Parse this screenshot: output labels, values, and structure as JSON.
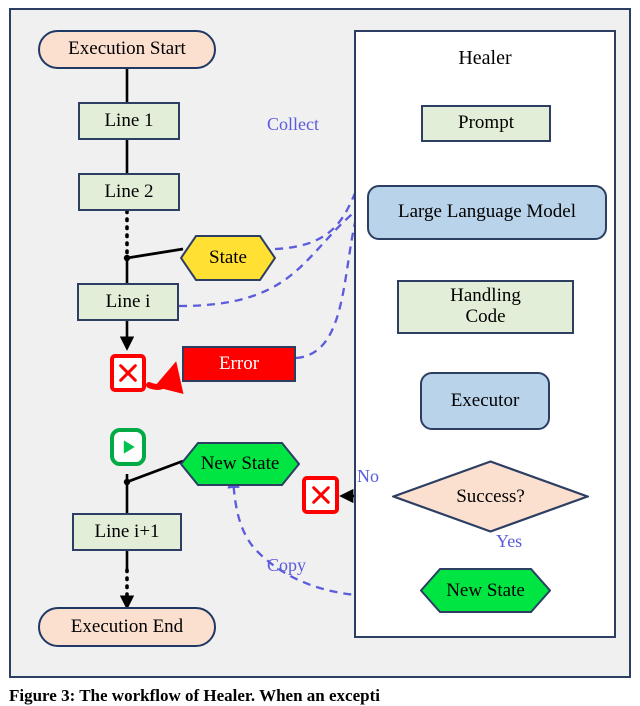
{
  "figure": {
    "caption": "Figure 3: The workflow of Healer. When an excepti",
    "background_color": "#f0f0f0",
    "border_color": "#2c3e62"
  },
  "colors": {
    "terminal_fill": "#fbe0d0",
    "process_fill": "#e2eed7",
    "llm_fill": "#b9d3ea",
    "state_fill": "#ffe033",
    "new_state_fill": "#00e542",
    "error_fill": "#ff0000",
    "outline": "#2c3e62",
    "dashed_edge": "#5b5bdd",
    "error_icon": "#ff0000",
    "play_icon": "#00aa44"
  },
  "left_flow": {
    "nodes": [
      {
        "id": "execution-start",
        "label": "Execution Start",
        "shape": "terminal"
      },
      {
        "id": "line-1",
        "label": "Line 1",
        "shape": "process"
      },
      {
        "id": "line-2",
        "label": "Line 2",
        "shape": "process"
      },
      {
        "id": "state",
        "label": "State",
        "shape": "hexagon"
      },
      {
        "id": "line-i",
        "label": "Line i",
        "shape": "process"
      },
      {
        "id": "error",
        "label": "Error",
        "shape": "error"
      },
      {
        "id": "new-state-left",
        "label": "New State",
        "shape": "hexagon"
      },
      {
        "id": "line-i-plus-1",
        "label": "Line i+1",
        "shape": "process"
      },
      {
        "id": "execution-end",
        "label": "Execution End",
        "shape": "terminal"
      }
    ],
    "icons": [
      {
        "id": "failure-icon",
        "name": "x-mark-icon"
      },
      {
        "id": "resume-icon",
        "name": "play-icon"
      }
    ]
  },
  "healer": {
    "title": "Healer",
    "nodes": [
      {
        "id": "prompt",
        "label": "Prompt",
        "shape": "process"
      },
      {
        "id": "large-language-model",
        "label": "Large Language Model",
        "shape": "rounded"
      },
      {
        "id": "handling-code",
        "label": "Handling",
        "label2": "Code",
        "shape": "process"
      },
      {
        "id": "executor",
        "label": "Executor",
        "shape": "rounded"
      },
      {
        "id": "success",
        "label": "Success?",
        "shape": "diamond"
      },
      {
        "id": "new-state-healer",
        "label": "New State",
        "shape": "hexagon"
      }
    ],
    "icons": [
      {
        "id": "retry-failure-icon",
        "name": "x-mark-icon"
      }
    ],
    "branch_labels": {
      "no": "No",
      "yes": "Yes"
    }
  },
  "edge_labels": {
    "collect": "Collect",
    "copy": "Copy"
  }
}
